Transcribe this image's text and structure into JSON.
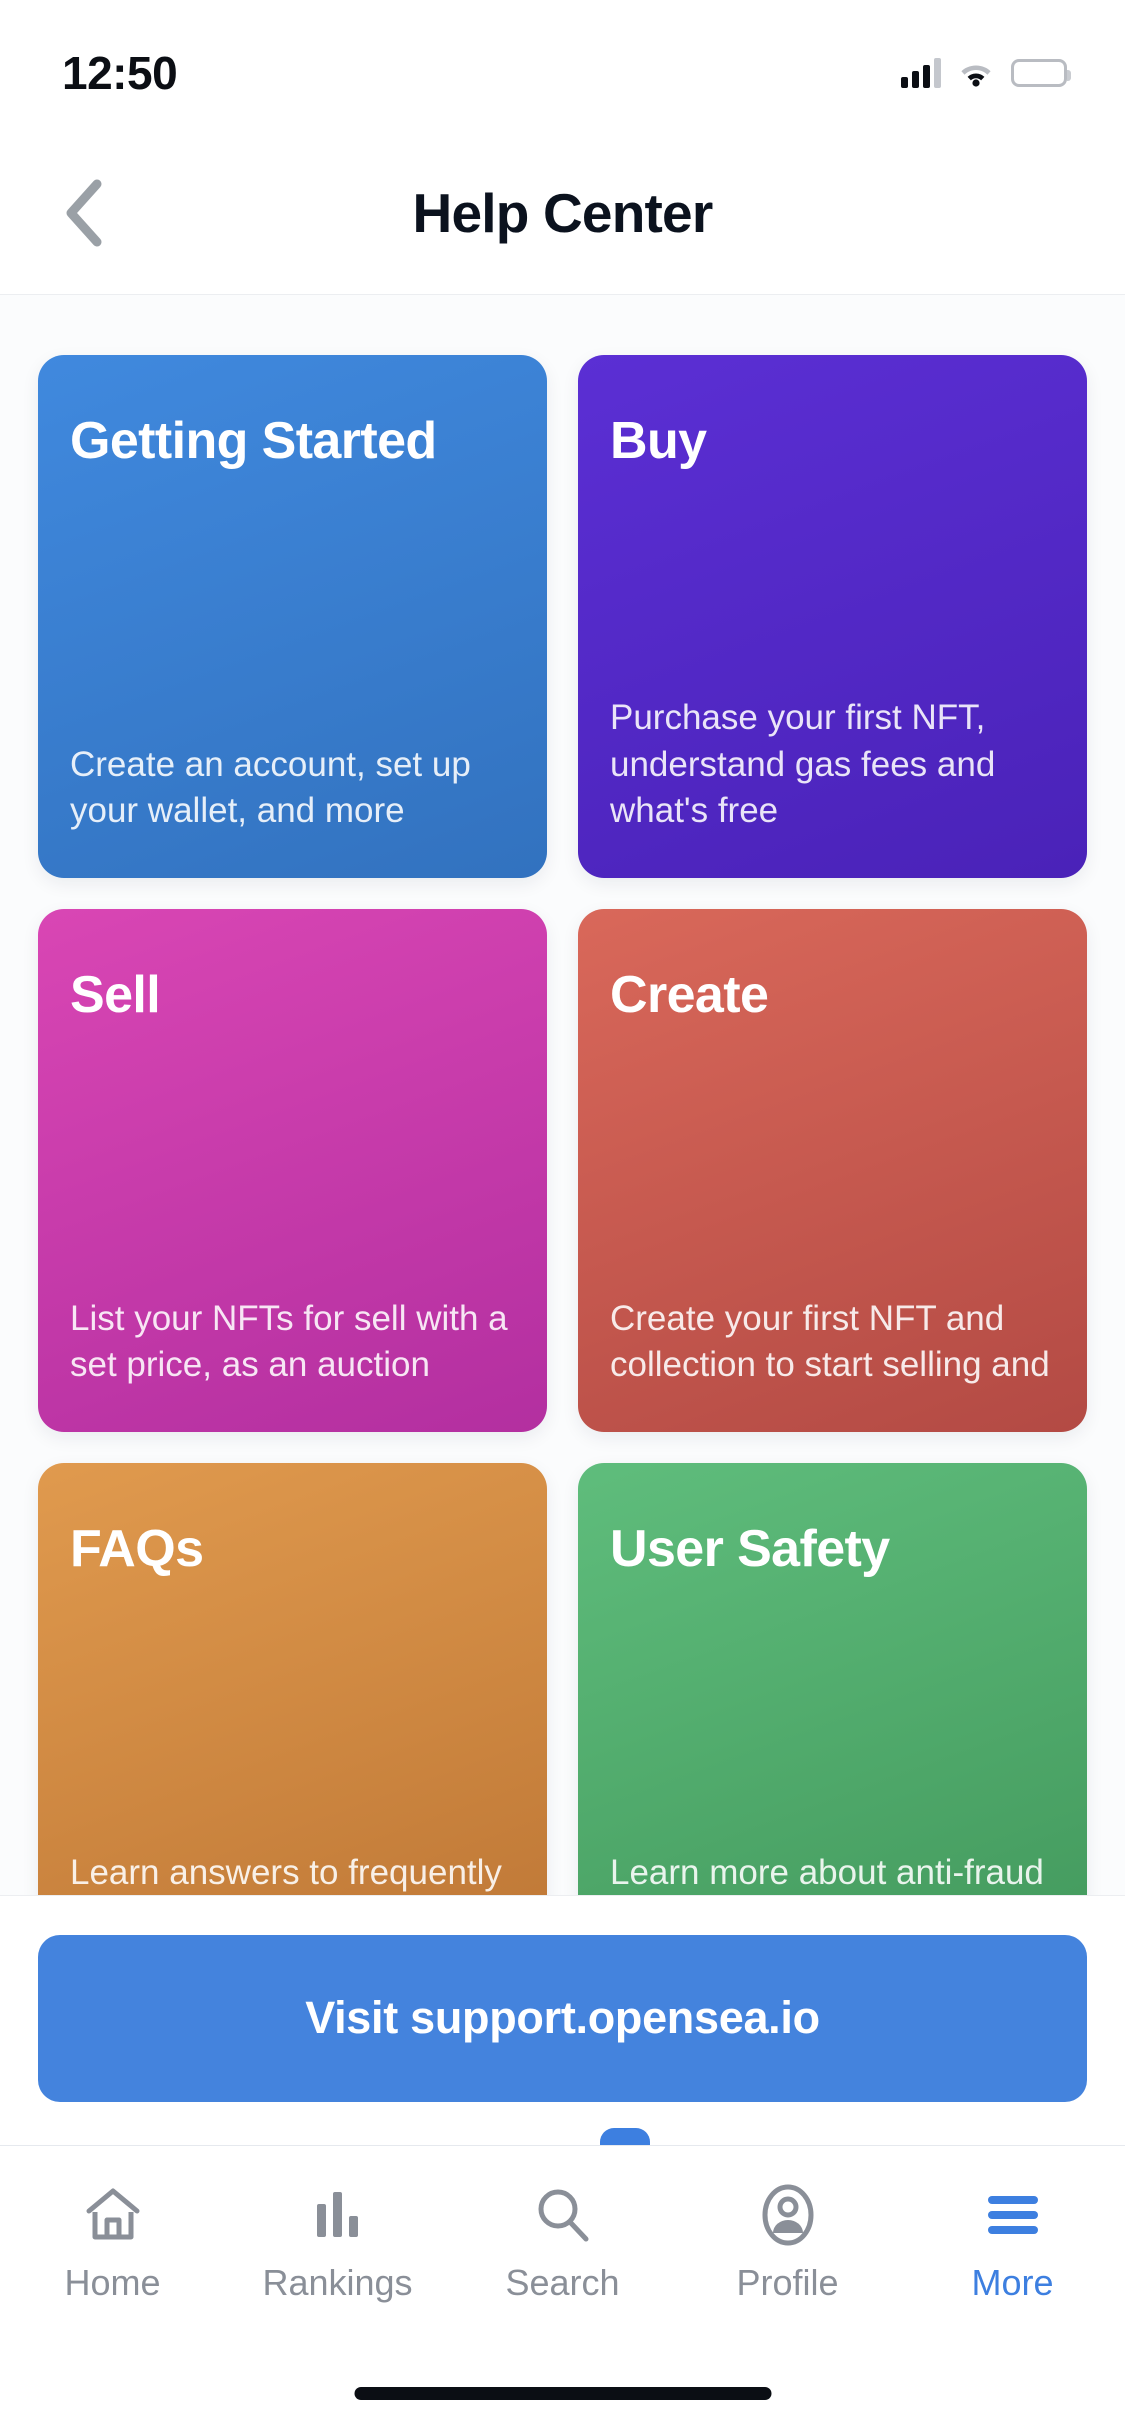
{
  "status_bar": {
    "time": "12:50",
    "cellular_icon": "cellular-bars-icon",
    "wifi_icon": "wifi-icon",
    "battery_icon": "battery-full-icon"
  },
  "header": {
    "back_icon": "chevron-left-icon",
    "title": "Help Center"
  },
  "cards": [
    {
      "title": "Getting Started",
      "description": "Create an account, set up your wallet, and more",
      "color_start": "#4089de",
      "color_end": "#3272bf"
    },
    {
      "title": "Buy",
      "description": "Purchase your first NFT, understand gas fees and what's free",
      "color_start": "#5b2fd4",
      "color_end": "#4a22b8"
    },
    {
      "title": "Sell",
      "description": "List your NFTs for sell with a set price, as an auction",
      "color_start": "#d946b4",
      "color_end": "#b32fa0"
    },
    {
      "title": "Create",
      "description": "Create your first NFT and collection to start selling and",
      "color_start": "#d9685a",
      "color_end": "#b34a44"
    },
    {
      "title": "FAQs",
      "description": "Learn answers to frequently asked questions on",
      "color_start": "#e09a4e",
      "color_end": "#bd7635"
    },
    {
      "title": "User Safety",
      "description": "Learn more about anti-fraud and user safety processes",
      "color_start": "#5fbd7c",
      "color_end": "#42985c"
    }
  ],
  "cta": {
    "label": "Visit support.opensea.io",
    "color": "#4483dd"
  },
  "tabbar": {
    "active_color": "#3d7fe0",
    "inactive_color": "#8a8f98",
    "items": [
      {
        "label": "Home",
        "icon": "home-icon",
        "active": false
      },
      {
        "label": "Rankings",
        "icon": "bar-chart-icon",
        "active": false
      },
      {
        "label": "Search",
        "icon": "search-icon",
        "active": false
      },
      {
        "label": "Profile",
        "icon": "user-circle-icon",
        "active": false
      },
      {
        "label": "More",
        "icon": "hamburger-menu-icon",
        "active": true
      }
    ]
  },
  "home_indicator": "home-indicator-bar"
}
